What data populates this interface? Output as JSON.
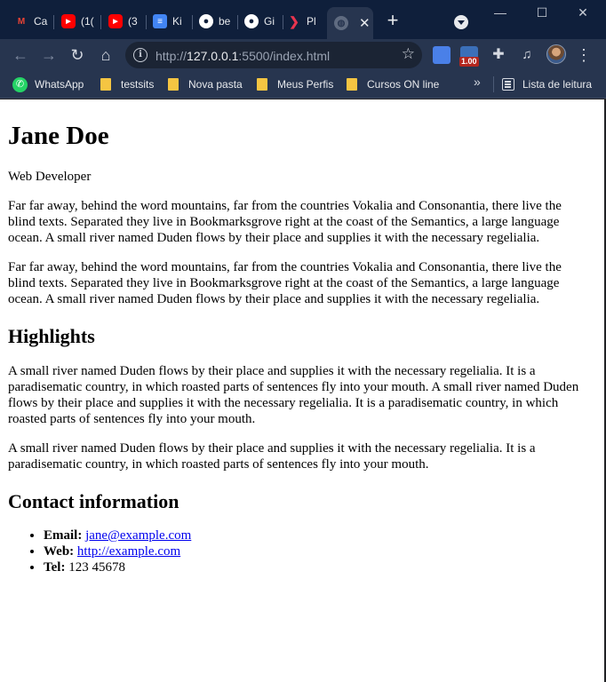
{
  "browser": {
    "tabs": [
      {
        "label": "Ca",
        "icon": "gmail-icon",
        "color": "#ea4335",
        "glyph": "M"
      },
      {
        "label": "(1(",
        "icon": "youtube-icon",
        "color": "#ff0000",
        "glyph": "▶"
      },
      {
        "label": "(3",
        "icon": "youtube-icon",
        "color": "#ff0000",
        "glyph": "▶"
      },
      {
        "label": "Ki",
        "icon": "document-icon",
        "color": "#4285f4",
        "glyph": "≡"
      },
      {
        "label": "be",
        "icon": "github-icon",
        "color": "#ffffff",
        "glyph": "●"
      },
      {
        "label": "Gi",
        "icon": "github-icon",
        "color": "#ffffff",
        "glyph": "●"
      },
      {
        "label": "Pl",
        "icon": "play-arrow-icon",
        "color": "#e8344e",
        "glyph": "❯"
      }
    ],
    "active_tab": {
      "icon": "globe-icon",
      "close_glyph": "✕"
    },
    "new_tab_glyph": "+",
    "window_controls": {
      "minimize": "—",
      "maximize": "☐",
      "close": "✕"
    },
    "toolbar": {
      "back": "←",
      "forward": "→",
      "reload": "↻",
      "home": "⌂",
      "url_prefix": "http://",
      "url_host": "127.0.0.1",
      "url_rest": ":5500/index.html",
      "star": "☆",
      "extension_badge": "1.00",
      "menu": "⋮"
    },
    "bookmarks": [
      {
        "label": "WhatsApp",
        "icon": "whatsapp-icon"
      },
      {
        "label": "testsits",
        "icon": "folder-icon"
      },
      {
        "label": "Nova pasta",
        "icon": "folder-icon"
      },
      {
        "label": "Meus Perfis",
        "icon": "folder-icon"
      },
      {
        "label": "Cursos ON line",
        "icon": "folder-icon"
      }
    ],
    "bookmarks_more": "»",
    "reading_list": "Lista de leitura"
  },
  "page": {
    "name": "Jane Doe",
    "role": "Web Developer",
    "intro": [
      "Far far away, behind the word mountains, far from the countries Vokalia and Consonantia, there live the blind texts. Separated they live in Bookmarksgrove right at the coast of the Semantics, a large language ocean. A small river named Duden flows by their place and supplies it with the necessary regelialia.",
      "Far far away, behind the word mountains, far from the countries Vokalia and Consonantia, there live the blind texts. Separated they live in Bookmarksgrove right at the coast of the Semantics, a large language ocean. A small river named Duden flows by their place and supplies it with the necessary regelialia."
    ],
    "highlights_heading": "Highlights",
    "highlights": [
      "A small river named Duden flows by their place and supplies it with the necessary regelialia. It is a paradisematic country, in which roasted parts of sentences fly into your mouth. A small river named Duden flows by their place and supplies it with the necessary regelialia. It is a paradisematic country, in which roasted parts of sentences fly into your mouth.",
      "A small river named Duden flows by their place and supplies it with the necessary regelialia. It is a paradisematic country, in which roasted parts of sentences fly into your mouth."
    ],
    "contact_heading": "Contact information",
    "contact": {
      "email_label": "Email:",
      "email": "jane@example.com",
      "web_label": "Web:",
      "web": "http://example.com",
      "tel_label": "Tel:",
      "tel": "123 45678"
    }
  }
}
